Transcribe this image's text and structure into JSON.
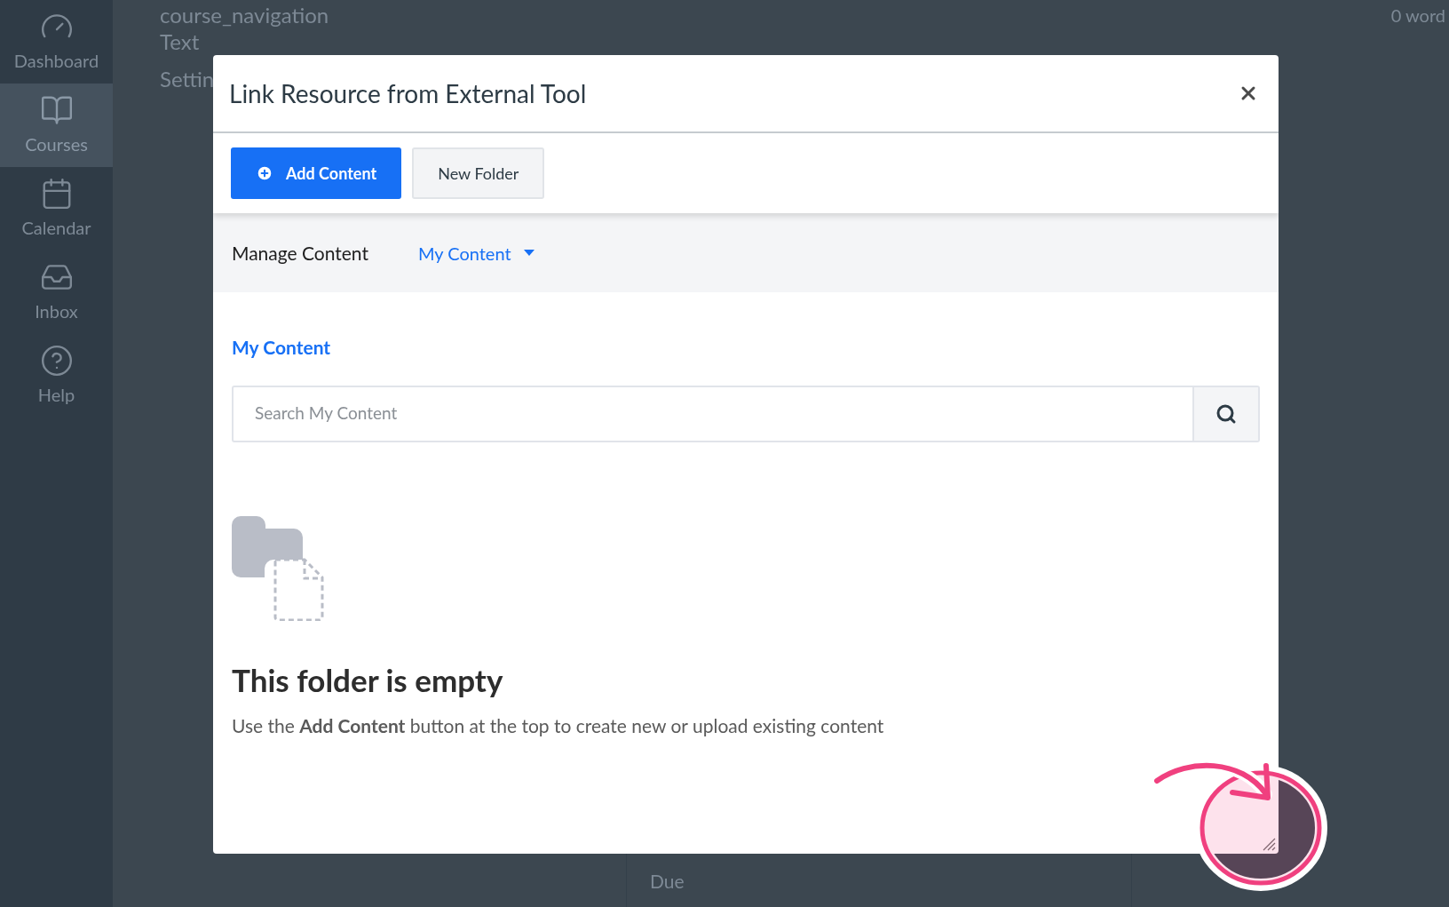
{
  "sidebar": {
    "items": [
      {
        "label": "Dashboard",
        "selected": false
      },
      {
        "label": "Courses",
        "selected": true
      },
      {
        "label": "Calendar",
        "selected": false
      },
      {
        "label": "Inbox",
        "selected": false
      },
      {
        "label": "Help",
        "selected": false
      }
    ]
  },
  "background": {
    "lines": [
      "course_navigation",
      "Text",
      "Settin"
    ],
    "word_count": "0 word",
    "due_label": "Due"
  },
  "dialog": {
    "title": "Link Resource from External Tool",
    "toolbar": [
      {
        "label": "Add Content",
        "kind": "primary"
      },
      {
        "label": "New Folder",
        "kind": "secondary"
      }
    ],
    "manage": {
      "label": "Manage Content",
      "dropdown": "My Content"
    },
    "section_title": "My Content",
    "search": {
      "placeholder": "Search My Content"
    },
    "empty": {
      "title": "This folder is empty",
      "message": "Use the **Add Content** button at the top to create new or upload existing content"
    }
  }
}
